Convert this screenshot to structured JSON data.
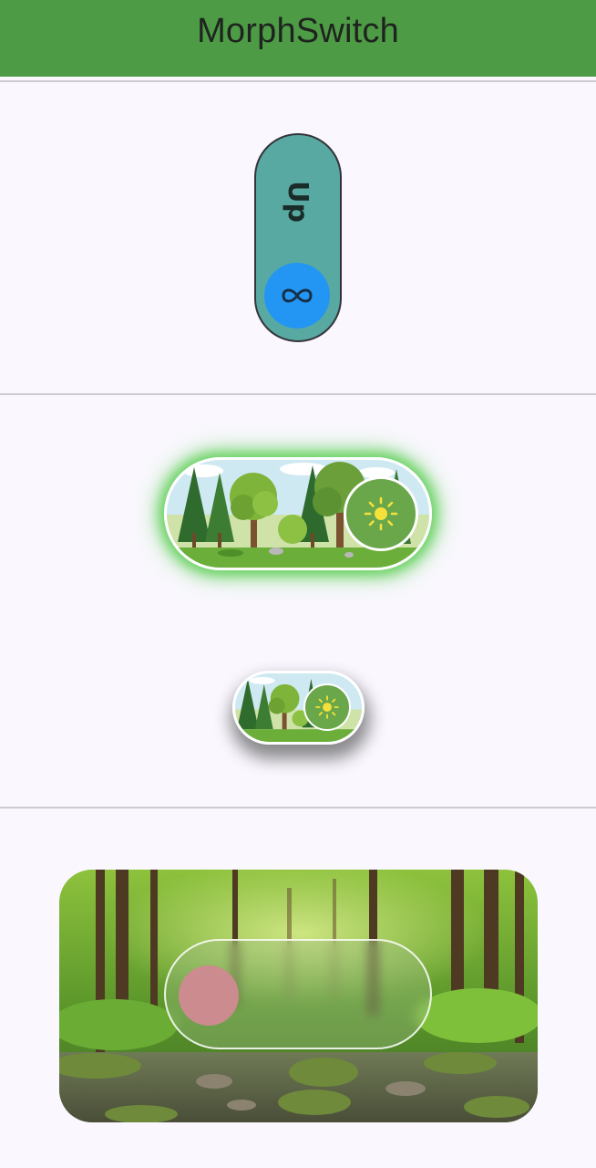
{
  "app_bar": {
    "title": "MorphSwitch",
    "color": "#4d9c45"
  },
  "vertical_switch": {
    "label": "Up",
    "track_color": "#58a9a2",
    "thumb_color": "#2396f3",
    "thumb_icon": "infinity-icon"
  },
  "forest_switch_large": {
    "state": "on",
    "thumb_icon": "sun-icon",
    "glow_color": "#46c83c"
  },
  "forest_switch_small": {
    "state": "on",
    "thumb_icon": "sun-icon"
  },
  "glass_switch": {
    "state": "off",
    "thumb_color": "#cb8b8f",
    "background": "forest-stream-photo"
  }
}
